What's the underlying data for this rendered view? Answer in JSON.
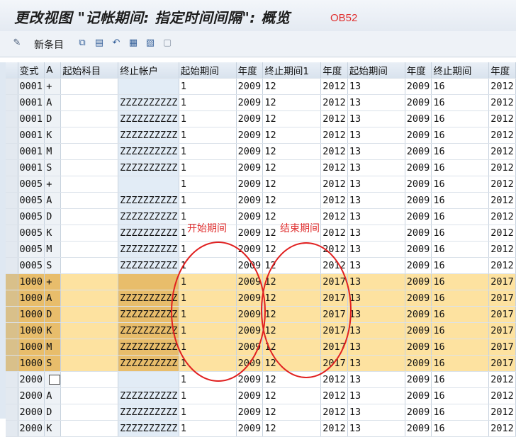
{
  "window": {
    "title": "更改视图 \"记帐期间: 指定时间间隔\": 概览",
    "annotation": "OB52"
  },
  "toolbar": {
    "new_entries_label": "新条目"
  },
  "table": {
    "columns": [
      "变式",
      "A",
      "起始科目",
      "终止帐户",
      "起始期间",
      "年度",
      "终止期间1",
      "年度",
      "起始期间",
      "年度",
      "终止期间",
      "年度"
    ],
    "rows": [
      [
        "0001",
        "+",
        "",
        "",
        "1",
        "2009",
        "12",
        "2012",
        "13",
        "2009",
        "16",
        "2012"
      ],
      [
        "0001",
        "A",
        "",
        "ZZZZZZZZZZ",
        "1",
        "2009",
        "12",
        "2012",
        "13",
        "2009",
        "16",
        "2012"
      ],
      [
        "0001",
        "D",
        "",
        "ZZZZZZZZZZ",
        "1",
        "2009",
        "12",
        "2012",
        "13",
        "2009",
        "16",
        "2012"
      ],
      [
        "0001",
        "K",
        "",
        "ZZZZZZZZZZ",
        "1",
        "2009",
        "12",
        "2012",
        "13",
        "2009",
        "16",
        "2012"
      ],
      [
        "0001",
        "M",
        "",
        "ZZZZZZZZZZ",
        "1",
        "2009",
        "12",
        "2012",
        "13",
        "2009",
        "16",
        "2012"
      ],
      [
        "0001",
        "S",
        "",
        "ZZZZZZZZZZ",
        "1",
        "2009",
        "12",
        "2012",
        "13",
        "2009",
        "16",
        "2012"
      ],
      [
        "0005",
        "+",
        "",
        "",
        "1",
        "2009",
        "12",
        "2012",
        "13",
        "2009",
        "16",
        "2012"
      ],
      [
        "0005",
        "A",
        "",
        "ZZZZZZZZZZ",
        "1",
        "2009",
        "12",
        "2012",
        "13",
        "2009",
        "16",
        "2012"
      ],
      [
        "0005",
        "D",
        "",
        "ZZZZZZZZZZ",
        "1",
        "2009",
        "12",
        "2012",
        "13",
        "2009",
        "16",
        "2012"
      ],
      [
        "0005",
        "K",
        "",
        "ZZZZZZZZZZ",
        "1",
        "2009",
        "12",
        "2012",
        "13",
        "2009",
        "16",
        "2012"
      ],
      [
        "0005",
        "M",
        "",
        "ZZZZZZZZZZ",
        "1",
        "2009",
        "12",
        "2012",
        "13",
        "2009",
        "16",
        "2012"
      ],
      [
        "0005",
        "S",
        "",
        "ZZZZZZZZZZ",
        "1",
        "2009",
        "12",
        "2012",
        "13",
        "2009",
        "16",
        "2012"
      ],
      [
        "1000",
        "+",
        "",
        "",
        "1",
        "2009",
        "12",
        "2017",
        "13",
        "2009",
        "16",
        "2017"
      ],
      [
        "1000",
        "A",
        "",
        "ZZZZZZZZZZ",
        "1",
        "2009",
        "12",
        "2017",
        "13",
        "2009",
        "16",
        "2017"
      ],
      [
        "1000",
        "D",
        "",
        "ZZZZZZZZZZ",
        "1",
        "2009",
        "12",
        "2017",
        "13",
        "2009",
        "16",
        "2017"
      ],
      [
        "1000",
        "K",
        "",
        "ZZZZZZZZZZ",
        "1",
        "2009",
        "12",
        "2017",
        "13",
        "2009",
        "16",
        "2017"
      ],
      [
        "1000",
        "M",
        "",
        "ZZZZZZZZZZ",
        "1",
        "2009",
        "12",
        "2017",
        "13",
        "2009",
        "16",
        "2017"
      ],
      [
        "1000",
        "S",
        "",
        "ZZZZZZZZZZ",
        "1",
        "2009",
        "12",
        "2017",
        "13",
        "2009",
        "16",
        "2017"
      ],
      [
        "2000",
        "",
        "",
        "",
        "1",
        "2009",
        "12",
        "2012",
        "13",
        "2009",
        "16",
        "2012"
      ],
      [
        "2000",
        "A",
        "",
        "ZZZZZZZZZZ",
        "1",
        "2009",
        "12",
        "2012",
        "13",
        "2009",
        "16",
        "2012"
      ],
      [
        "2000",
        "D",
        "",
        "ZZZZZZZZZZ",
        "1",
        "2009",
        "12",
        "2012",
        "13",
        "2009",
        "16",
        "2012"
      ],
      [
        "2000",
        "K",
        "",
        "ZZZZZZZZZZ",
        "1",
        "2009",
        "12",
        "2012",
        "13",
        "2009",
        "16",
        "2012"
      ]
    ],
    "highlighted_variant": "1000"
  },
  "annotations": {
    "start_period": "开始期间",
    "end_period": "结束期间"
  },
  "colors": {
    "highlight_key": "#e8bd6b",
    "highlight_input": "#fde2a0",
    "annotation_red": "#e02020"
  }
}
